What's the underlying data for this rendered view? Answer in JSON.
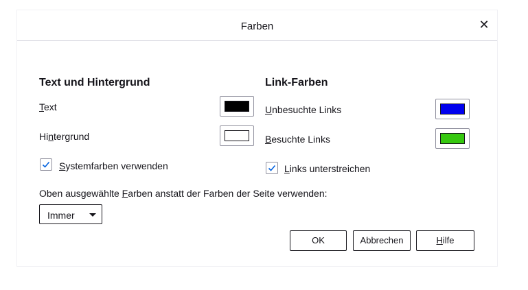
{
  "dialog": {
    "title": "Farben",
    "close_glyph": "✕"
  },
  "text_background": {
    "heading": "Text und Hintergrund",
    "text_label_accesskey": "T",
    "text_label_rest": "ext",
    "text_color": "#000000",
    "background_label_pre": "Hi",
    "background_label_accesskey": "n",
    "background_label_rest": "tergrund",
    "background_color": "#ffffff",
    "system_colors_accesskey": "S",
    "system_colors_rest": "ystemfarben verwenden",
    "system_colors_checked": true
  },
  "link_colors": {
    "heading": "Link-Farben",
    "unvisited_accesskey": "U",
    "unvisited_rest": "nbesuchte Links",
    "unvisited_color": "#0000ee",
    "visited_accesskey": "B",
    "visited_rest": "esuchte Links",
    "visited_color": "#36c80f",
    "underline_accesskey": "L",
    "underline_rest": "inks unterstreichen",
    "underline_checked": true
  },
  "override": {
    "label_pre": "Oben ausgewählte ",
    "label_accesskey": "F",
    "label_rest": "arben anstatt der Farben der Seite verwenden:",
    "selected": "Immer"
  },
  "buttons": {
    "ok": "OK",
    "cancel": "Abbrechen",
    "help_accesskey": "H",
    "help_rest": "ilfe"
  },
  "colors": {
    "checkmark": "#0060df"
  }
}
